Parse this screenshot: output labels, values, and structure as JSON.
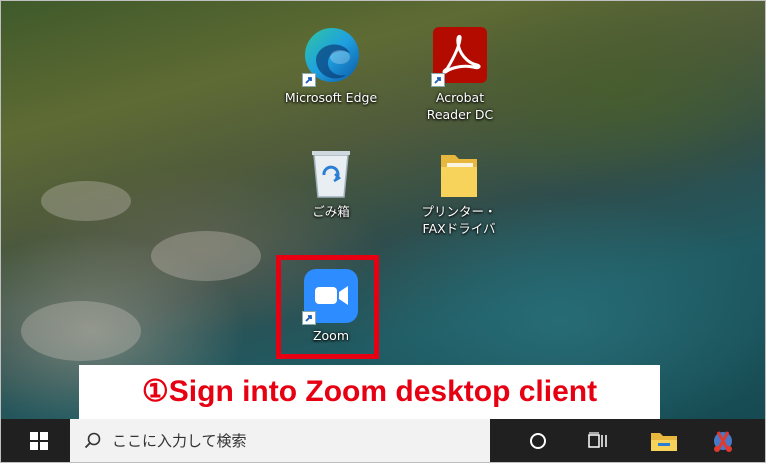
{
  "desktop": {
    "icons": [
      {
        "label": "Microsoft Edge",
        "icon": "edge-icon"
      },
      {
        "label": "Acrobat Reader DC",
        "icon": "acrobat-icon"
      },
      {
        "label": "ごみ箱",
        "icon": "recycle-bin-icon"
      },
      {
        "label": "プリンター・FAXドライバ",
        "icon": "folder-icon"
      },
      {
        "label": "Zoom",
        "icon": "zoom-icon"
      }
    ]
  },
  "caption": "①Sign into Zoom desktop client",
  "taskbar": {
    "search_placeholder": "ここに入力して検索",
    "icons": [
      "windows-start-icon",
      "search-icon",
      "cortana-icon",
      "task-view-icon",
      "file-explorer-icon",
      "snipping-tool-icon"
    ]
  },
  "colors": {
    "highlight": "#e60012",
    "taskbar": "#202020",
    "edge_blue": "#1fa0e0",
    "acrobat_red": "#b30b00",
    "zoom_blue": "#2d8cff"
  }
}
